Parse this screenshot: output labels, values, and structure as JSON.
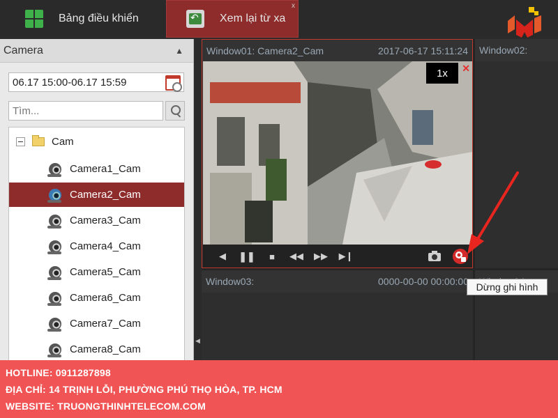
{
  "tabs": {
    "dashboard_label": "Bảng điều khiển",
    "remote_playback_label": "Xem lại từ xa",
    "close_glyph": "x"
  },
  "left_panel": {
    "title": "Camera",
    "date_range": "06.17 15:00-06.17 15:59",
    "search_placeholder": "Tìm...",
    "tree": {
      "root_label": "Cam",
      "cameras": [
        {
          "label": "Camera1_Cam",
          "selected": false
        },
        {
          "label": "Camera2_Cam",
          "selected": true
        },
        {
          "label": "Camera3_Cam",
          "selected": false
        },
        {
          "label": "Camera4_Cam",
          "selected": false
        },
        {
          "label": "Camera5_Cam",
          "selected": false
        },
        {
          "label": "Camera6_Cam",
          "selected": false
        },
        {
          "label": "Camera7_Cam",
          "selected": false
        },
        {
          "label": "Camera8_Cam",
          "selected": false
        }
      ]
    }
  },
  "windows": {
    "win1": {
      "name": "Window01:",
      "camera": "Camera2_Cam",
      "time": "2017-06-17 15:11:24",
      "speed": "1x",
      "close": "✕"
    },
    "win2": {
      "name": "Window02:"
    },
    "win3": {
      "name": "Window03:",
      "time": "0000-00-00 00:00:00"
    },
    "win4": {
      "name": "Window04"
    }
  },
  "tooltip": "Dừng ghi hình",
  "footer": {
    "hotline": "HOTLINE: 0911287898",
    "address": "ĐỊA CHỈ: 14 TRỊNH LỖI, PHƯỜNG PHÚ THỌ HÒA, TP. HCM",
    "website": "WEBSITE: TRUONGTHINHTELECOM.COM"
  },
  "colors": {
    "accent": "#8e2b2b",
    "footer": "#f05454",
    "record_button": "#d42a2a",
    "annotation_arrow": "#e8261f"
  }
}
